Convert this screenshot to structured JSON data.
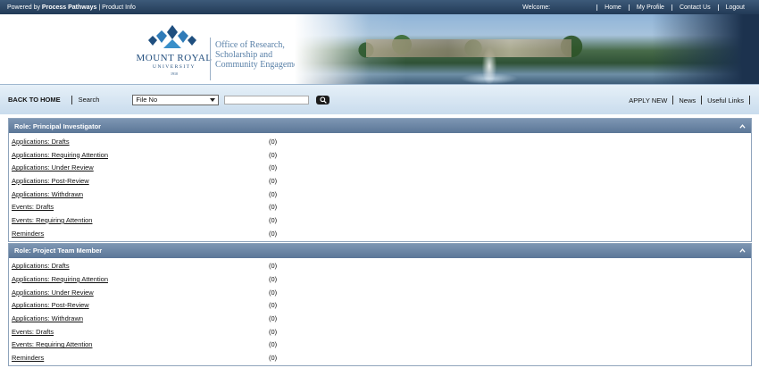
{
  "topbar": {
    "powered_prefix": "Powered by ",
    "powered_brand": "Process Pathways",
    "product_info": " | Product Info",
    "welcome": "Welcome:",
    "links": [
      "Home",
      "My Profile",
      "Contact Us",
      "Logout"
    ]
  },
  "banner": {
    "university_name": "MOUNT ROYAL",
    "university_sub": "UNIVERSITY",
    "university_year": "1910",
    "office_line1": "Office of Research,",
    "office_line2": "Scholarship and",
    "office_line3": "Community Engagement"
  },
  "searchbar": {
    "back_home": "BACK TO HOME",
    "search_label": "Search",
    "select_value": "File No",
    "input_value": "",
    "right_links": [
      "APPLY NEW",
      "News",
      "Useful Links"
    ]
  },
  "panels": [
    {
      "title": "Role: Principal Investigator",
      "items": [
        {
          "label": "Applications: Drafts",
          "count": "(0)"
        },
        {
          "label": "Applications: Requiring Attention",
          "count": "(0)"
        },
        {
          "label": "Applications: Under Review",
          "count": "(0)"
        },
        {
          "label": "Applications: Post-Review",
          "count": "(0)"
        },
        {
          "label": "Applications: Withdrawn",
          "count": "(0)"
        },
        {
          "label": "Events: Drafts",
          "count": "(0)"
        },
        {
          "label": "Events: Requiring Attention",
          "count": "(0)"
        },
        {
          "label": "Reminders",
          "count": "(0)"
        }
      ]
    },
    {
      "title": "Role: Project Team Member",
      "items": [
        {
          "label": "Applications: Drafts",
          "count": "(0)"
        },
        {
          "label": "Applications: Requiring Attention",
          "count": "(0)"
        },
        {
          "label": "Applications: Under Review",
          "count": "(0)"
        },
        {
          "label": "Applications: Post-Review",
          "count": "(0)"
        },
        {
          "label": "Applications: Withdrawn",
          "count": "(0)"
        },
        {
          "label": "Events: Drafts",
          "count": "(0)"
        },
        {
          "label": "Events: Requiring Attention",
          "count": "(0)"
        },
        {
          "label": "Reminders",
          "count": "(0)"
        }
      ]
    }
  ],
  "icons": {
    "search": "magnifier-icon",
    "collapse": "chevron-up-icon",
    "dropdown": "caret-down-icon"
  },
  "colors": {
    "topbar": "#2c4766",
    "panel_header": "#6a84a3",
    "searchbar": "#d6e5f2"
  }
}
